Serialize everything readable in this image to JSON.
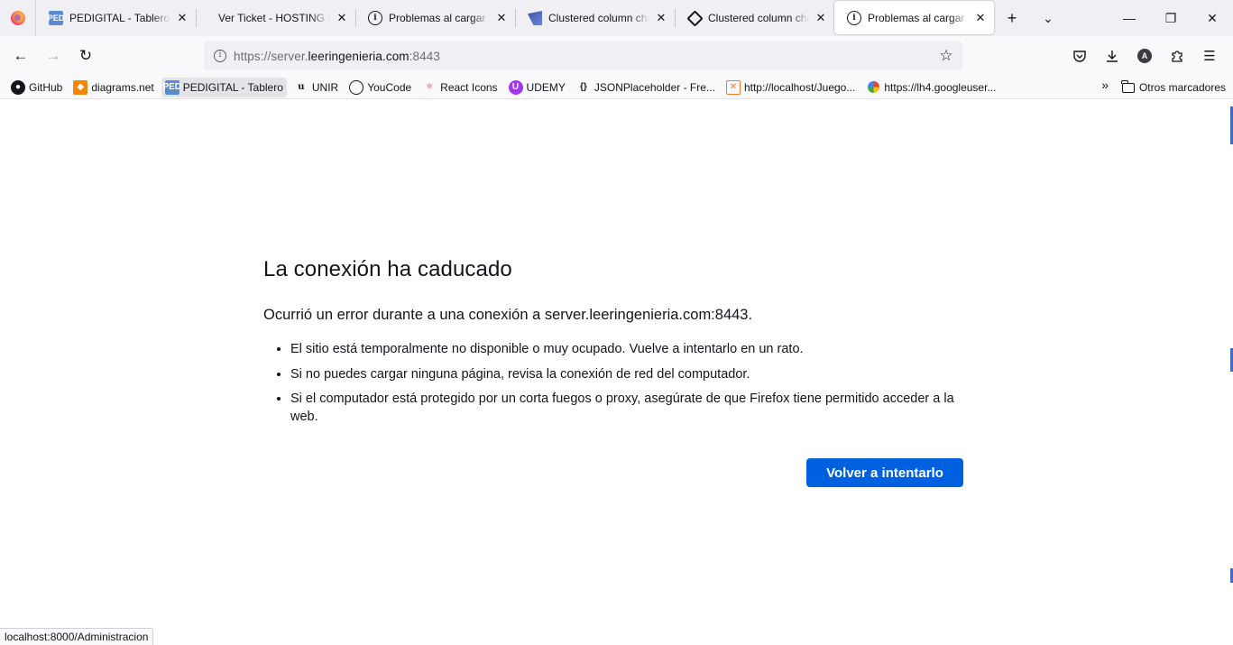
{
  "tabs": [
    {
      "title": "PEDIGITAL - Tablero Mi",
      "favicon": "pedigital-icon"
    },
    {
      "title": "Ver Ticket - HOSTING RED SOLUCIONES",
      "favicon": ""
    },
    {
      "title": "Problemas al cargar la página",
      "favicon": "info-icon"
    },
    {
      "title": "Clustered column chart",
      "favicon": "powerbi-icon"
    },
    {
      "title": "Clustered column chart",
      "favicon": "hex-icon"
    },
    {
      "title": "Problemas al cargar la página",
      "favicon": "info-icon",
      "active": true
    }
  ],
  "nav": {
    "url_scheme": "https://server.",
    "url_host": "leeringenieria.com",
    "url_port": ":8443"
  },
  "bookmarks": [
    {
      "label": "GitHub",
      "icon": "github-icon"
    },
    {
      "label": "diagrams.net",
      "icon": "diagrams-icon"
    },
    {
      "label": "PEDIGITAL - Tablero",
      "icon": "pedigital-icon"
    },
    {
      "label": "UNIR",
      "icon": "unir-icon"
    },
    {
      "label": "YouCode",
      "icon": "globe-icon"
    },
    {
      "label": "React Icons",
      "icon": "react-icon"
    },
    {
      "label": "UDEMY",
      "icon": "udemy-icon"
    },
    {
      "label": "JSONPlaceholder - Fre...",
      "icon": "json-icon"
    },
    {
      "label": "http://localhost/Juego...",
      "icon": "xampp-icon"
    },
    {
      "label": "https://lh4.googleuser...",
      "icon": "photos-icon"
    }
  ],
  "bookmarks_other": "Otros marcadores",
  "error": {
    "title": "La conexión ha caducado",
    "lead": "Ocurrió un error durante a una conexión a server.leeringenieria.com:8443.",
    "items": [
      "El sitio está temporalmente no disponible o muy ocupado. Vuelve a intentarlo en un rato.",
      "Si no puedes cargar ninguna página, revisa la conexión de red del computador.",
      "Si el computador está protegido por un corta fuegos o proxy, asegúrate de que Firefox tiene permitido acceder a la web."
    ],
    "retry_label": "Volver a intentarlo"
  },
  "status_url": "localhost:8000/Administracion",
  "colors": {
    "accent": "#0061e0",
    "tabstrip": "#f0f0f4",
    "toolbar": "#f9f9fb"
  }
}
